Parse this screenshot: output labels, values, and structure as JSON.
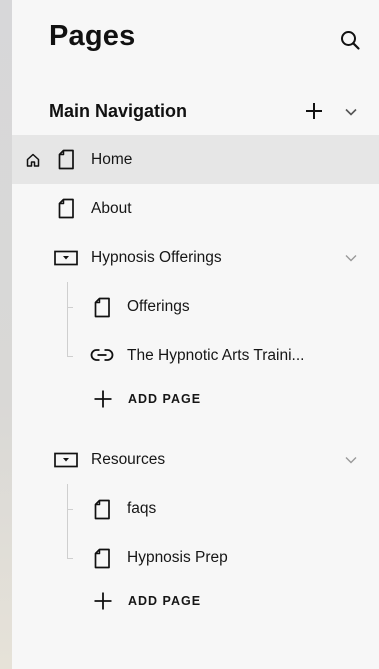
{
  "header": {
    "title": "Pages"
  },
  "section": {
    "title": "Main Navigation"
  },
  "pages": {
    "home": "Home",
    "about": "About",
    "hypnosis_offerings": {
      "label": "Hypnosis Offerings",
      "children": [
        "Offerings",
        "The Hypnotic Arts Traini..."
      ],
      "add_label": "ADD PAGE"
    },
    "resources": {
      "label": "Resources",
      "children": [
        "faqs",
        "Hypnosis Prep"
      ],
      "add_label": "ADD PAGE"
    }
  },
  "icons": {
    "search": "search-icon",
    "add": "plus-icon",
    "collapse": "chevron-down-icon",
    "home": "home-icon",
    "page": "page-icon",
    "folder": "folder-icon",
    "link": "link-icon"
  },
  "colors": {
    "selected_row": "#e6e6e6",
    "panel": "#f7f7f7",
    "text": "#161616"
  }
}
